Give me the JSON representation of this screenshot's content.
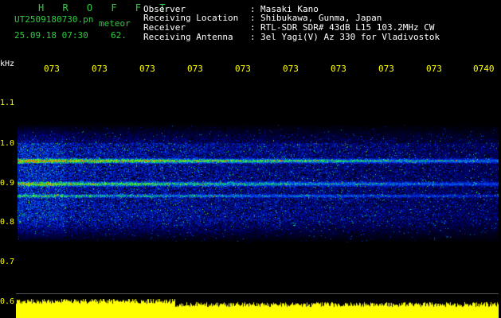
{
  "app": {
    "title": "H R O F F T",
    "file": "UT2509180730.pn",
    "category": "meteor",
    "datetime": "25.09.18 07:30",
    "count": "62."
  },
  "info": {
    "labels": [
      "Observer",
      "Receiving Location",
      "Receiver",
      "Receiving Antenna"
    ],
    "sep": [
      ":",
      ":",
      ":",
      ":"
    ],
    "values": [
      "Masaki Kano",
      "Shibukawa, Gunma, Japan",
      "RTL-SDR SDR# 43dB L15 103.2MHz CW",
      "3el Yagi(V) Az 330 for Vladivostok"
    ]
  },
  "axis": {
    "unit": "kHz",
    "yticks": [
      "1.1",
      "1.0",
      "0.9",
      "0.8",
      "0.7",
      "0.6"
    ],
    "xticks": [
      "073",
      "073",
      "073",
      "073",
      "073",
      "073",
      "073",
      "073",
      "073",
      "0740"
    ]
  },
  "colors": {
    "text_green": "#2ecc40",
    "text_yellow": "#ffff00",
    "text_white": "#ffffff"
  }
}
